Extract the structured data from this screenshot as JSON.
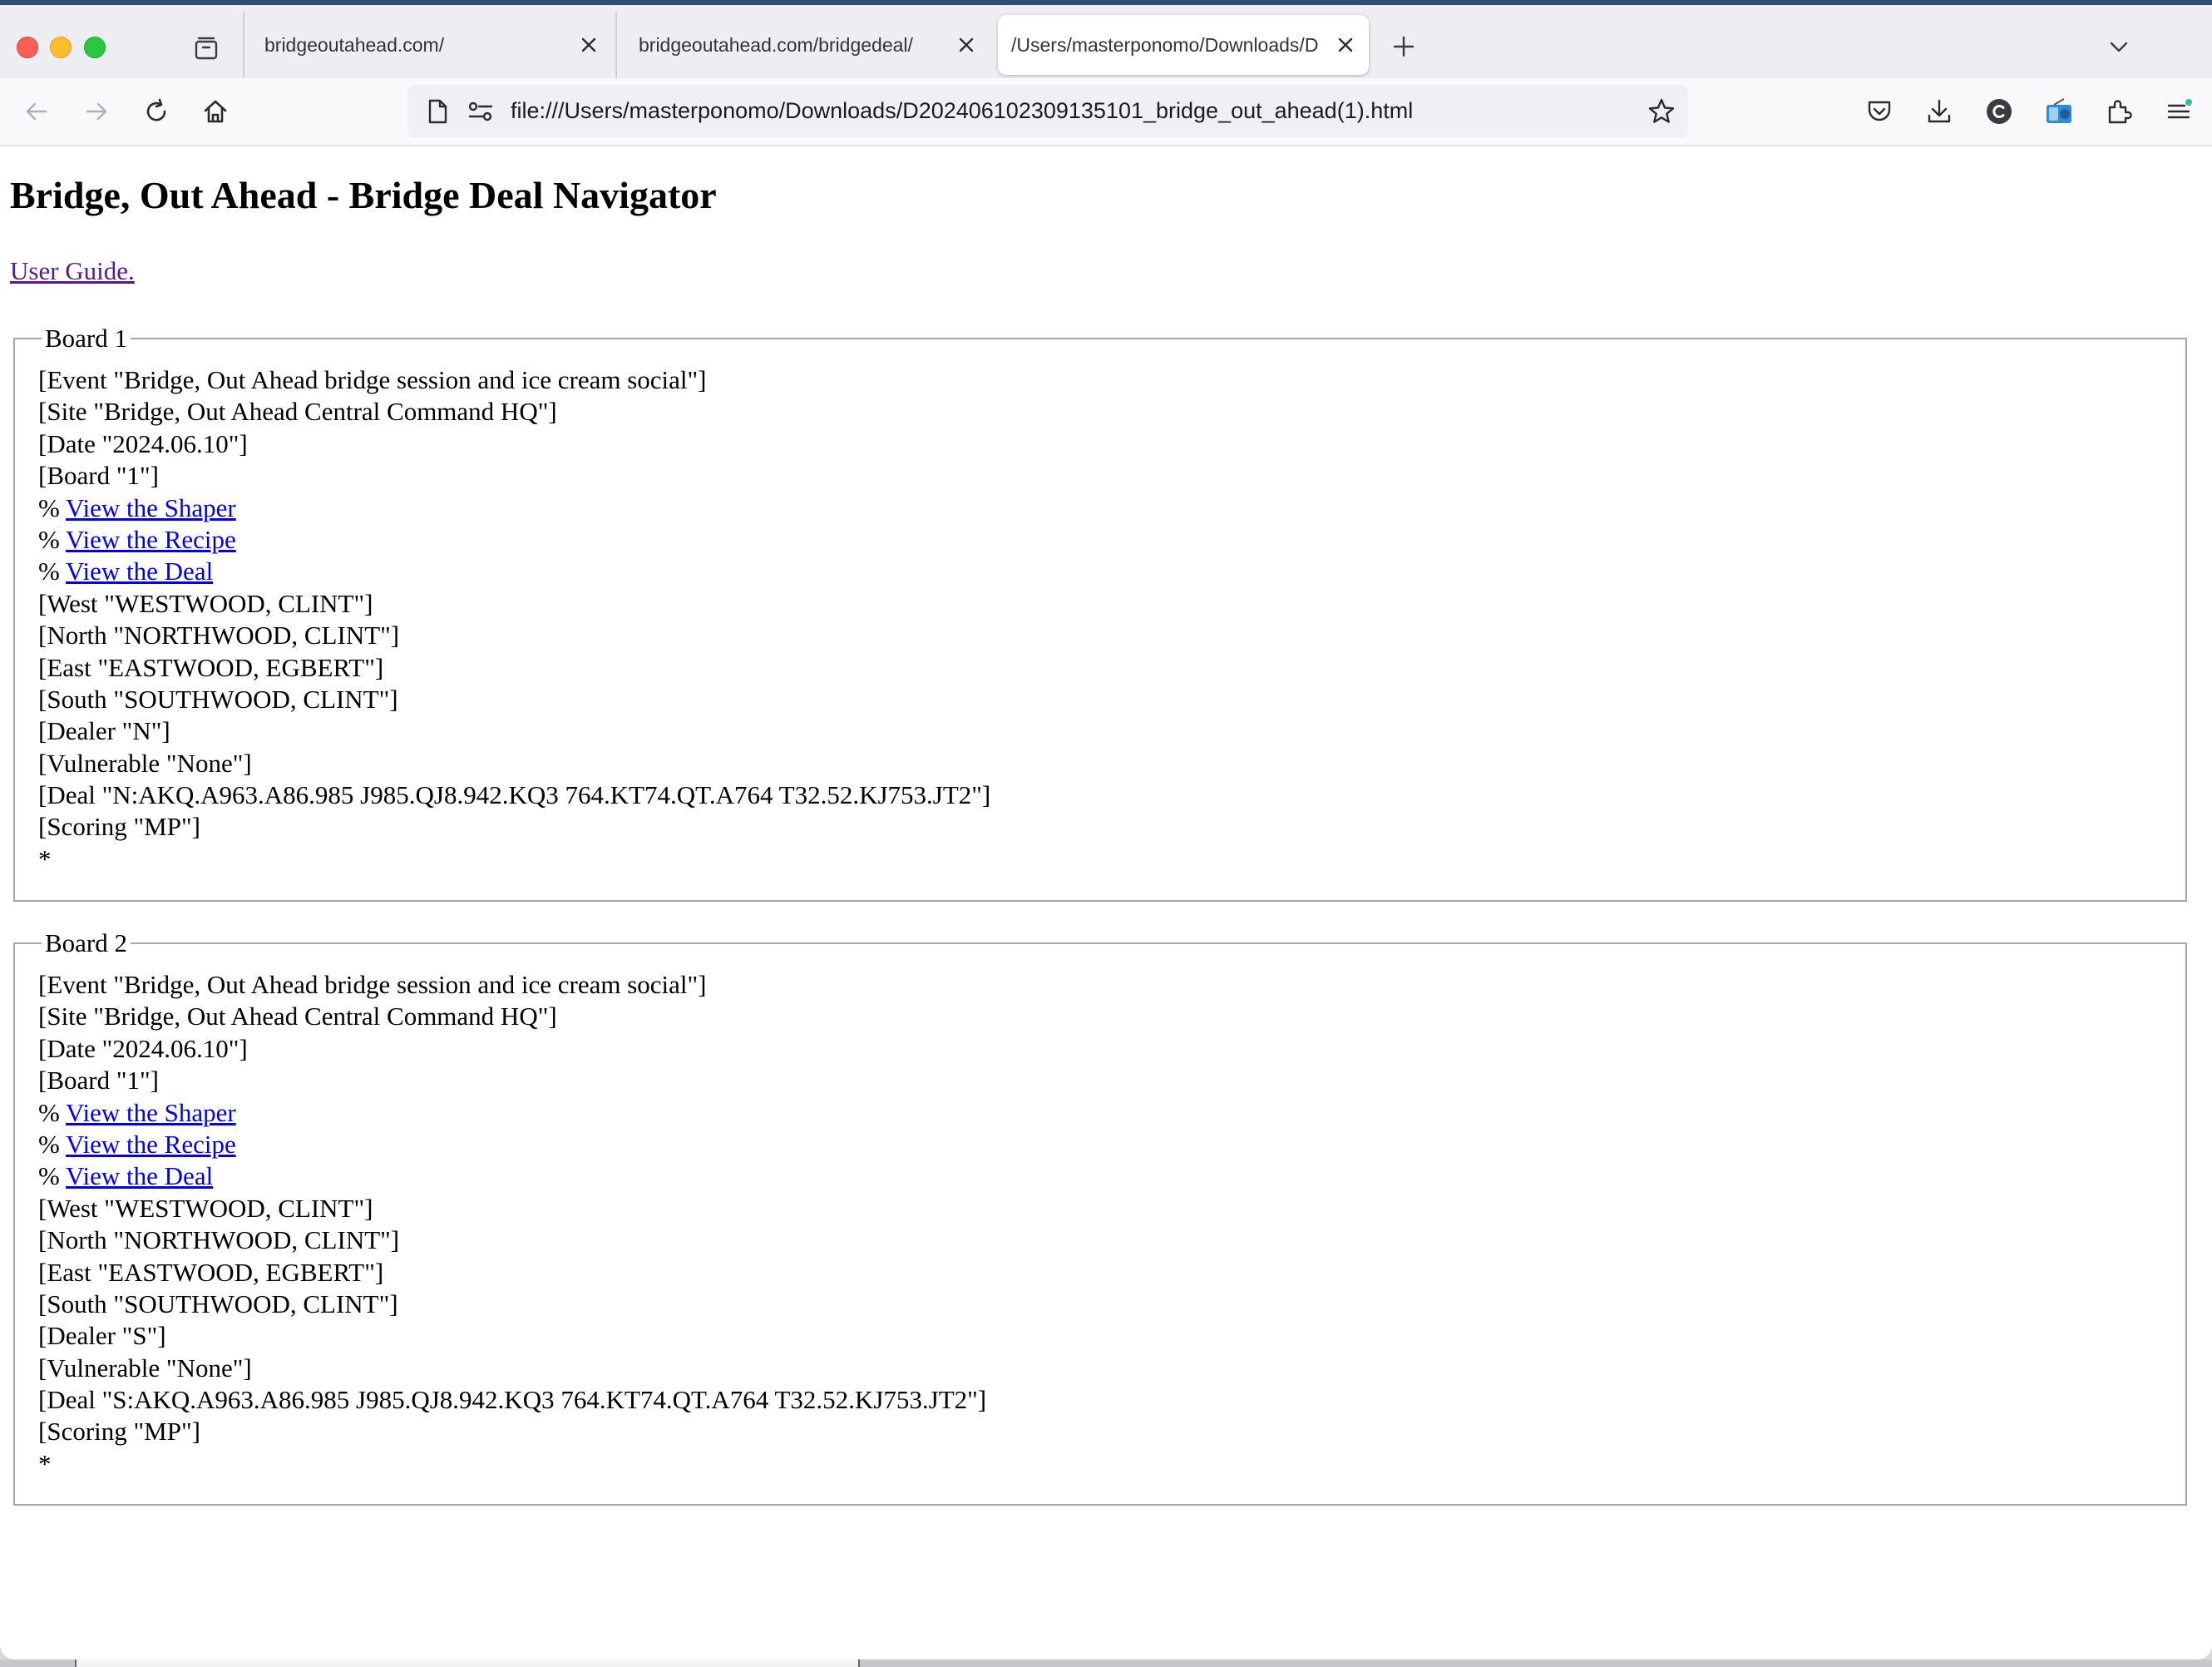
{
  "browser": {
    "tabs": [
      {
        "title": "bridgeoutahead.com/"
      },
      {
        "title": "bridgeoutahead.com/bridgedeal/"
      },
      {
        "title": "/Users/masterponomo/Downloads/D"
      }
    ],
    "url": "file:///Users/masterponomo/Downloads/D202406102309135101_bridge_out_ahead(1).html"
  },
  "page": {
    "heading": "Bridge, Out Ahead - Bridge Deal Navigator",
    "user_guide_link": "User Guide.",
    "boards": [
      {
        "legend": "Board 1",
        "event": "[Event \"Bridge, Out Ahead bridge session and ice cream social\"]",
        "site": "[Site \"Bridge, Out Ahead Central Command HQ\"]",
        "date": "[Date \"2024.06.10\"]",
        "board": "[Board \"1\"]",
        "pct": "% ",
        "link_shaper": "View the Shaper",
        "link_recipe": "View the Recipe",
        "link_deal": "View the Deal",
        "west": "[West \"WESTWOOD, CLINT\"]",
        "north": "[North \"NORTHWOOD, CLINT\"]",
        "east": "[East \"EASTWOOD, EGBERT\"]",
        "south": "[South \"SOUTHWOOD, CLINT\"]",
        "dealer": "[Dealer \"N\"]",
        "vulnerable": "[Vulnerable \"None\"]",
        "deal": "[Deal \"N:AKQ.A963.A86.985 J985.QJ8.942.KQ3 764.KT74.QT.A764 T32.52.KJ753.JT2\"]",
        "scoring": "[Scoring \"MP\"]",
        "terminator": "*"
      },
      {
        "legend": "Board 2",
        "event": "[Event \"Bridge, Out Ahead bridge session and ice cream social\"]",
        "site": "[Site \"Bridge, Out Ahead Central Command HQ\"]",
        "date": "[Date \"2024.06.10\"]",
        "board": "[Board \"1\"]",
        "pct": "% ",
        "link_shaper": "View the Shaper",
        "link_recipe": "View the Recipe",
        "link_deal": "View the Deal",
        "west": "[West \"WESTWOOD, CLINT\"]",
        "north": "[North \"NORTHWOOD, CLINT\"]",
        "east": "[East \"EASTWOOD, EGBERT\"]",
        "south": "[South \"SOUTHWOOD, CLINT\"]",
        "dealer": "[Dealer \"S\"]",
        "vulnerable": "[Vulnerable \"None\"]",
        "deal": "[Deal \"S:AKQ.A963.A86.985 J985.QJ8.942.KQ3 764.KT74.QT.A764 T32.52.KJ753.JT2\"]",
        "scoring": "[Scoring \"MP\"]",
        "terminator": "*"
      }
    ]
  },
  "icons": {
    "traffic_lights": [
      "close-window-icon",
      "minimize-window-icon",
      "zoom-window-icon"
    ],
    "toolbar_right": [
      "pocket-icon",
      "downloads-icon",
      "account-icon",
      "extension-media-icon",
      "extensions-icon",
      "menu-icon"
    ]
  },
  "colors": {
    "link": "#0000ee",
    "visited_link": "#551a8b",
    "fieldset_border": "#a6a6a6"
  }
}
